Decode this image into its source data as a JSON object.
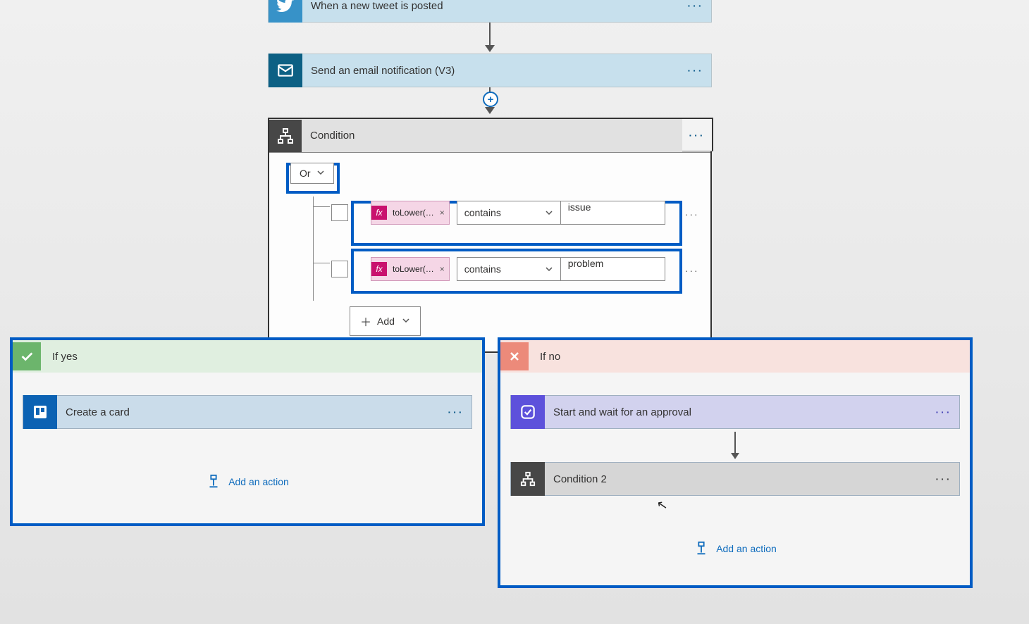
{
  "trigger": {
    "title": "When a new tweet is posted"
  },
  "email": {
    "title": "Send an email notification (V3)"
  },
  "condition": {
    "title": "Condition",
    "group_operator": "Or",
    "rows": [
      {
        "fx": "toLower(…",
        "operator": "contains",
        "value": "issue"
      },
      {
        "fx": "toLower(…",
        "operator": "contains",
        "value": "problem"
      }
    ],
    "add_label": "Add"
  },
  "branches": {
    "yes": {
      "label": "If yes",
      "cards": [
        {
          "kind": "trello",
          "title": "Create a card"
        }
      ],
      "add_action": "Add an action"
    },
    "no": {
      "label": "If no",
      "cards": [
        {
          "kind": "approval",
          "title": "Start and wait for an approval"
        },
        {
          "kind": "condition",
          "title": "Condition 2"
        }
      ],
      "add_action": "Add an action"
    }
  },
  "colors": {
    "highlight": "#005cc4",
    "link": "#0f6cbd"
  }
}
